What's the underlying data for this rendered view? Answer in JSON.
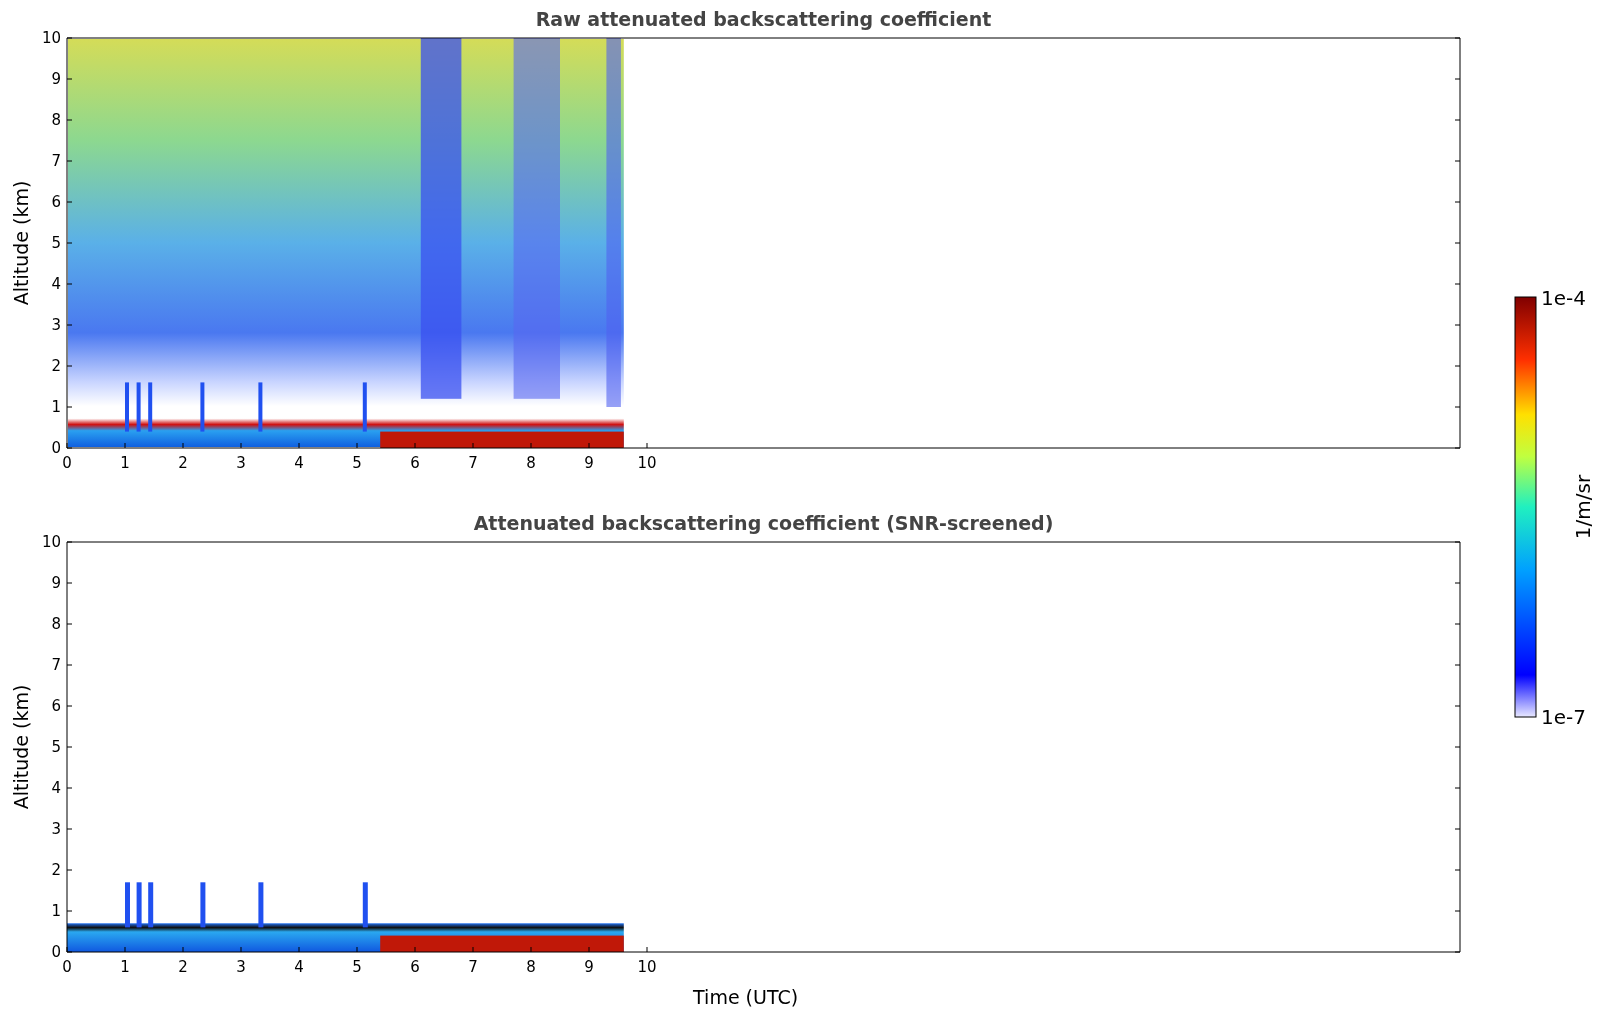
{
  "panels": [
    {
      "kind": "raw",
      "title": "Raw attenuated backscattering coefficient",
      "ylabel": "Altitude (km)",
      "yticks": [
        "10",
        "9",
        "8",
        "7",
        "6",
        "5",
        "4",
        "3",
        "2",
        "1",
        "0"
      ],
      "xticks": [
        "0",
        "1",
        "2",
        "3",
        "4",
        "5",
        "6",
        "7",
        "8",
        "9",
        "10"
      ]
    },
    {
      "kind": "screened",
      "title": "Attenuated backscattering coefficient (SNR-screened)",
      "ylabel": "Altitude (km)",
      "yticks": [
        "10",
        "9",
        "8",
        "7",
        "6",
        "5",
        "4",
        "3",
        "2",
        "1",
        "0"
      ],
      "xticks": [
        "0",
        "1",
        "2",
        "3",
        "4",
        "5",
        "6",
        "7",
        "8",
        "9",
        "10"
      ],
      "xlabel": "Time (UTC)"
    }
  ],
  "colorbar": {
    "max_label": "1e-4",
    "min_label": "1e-7",
    "label": "1/m/sr"
  }
}
